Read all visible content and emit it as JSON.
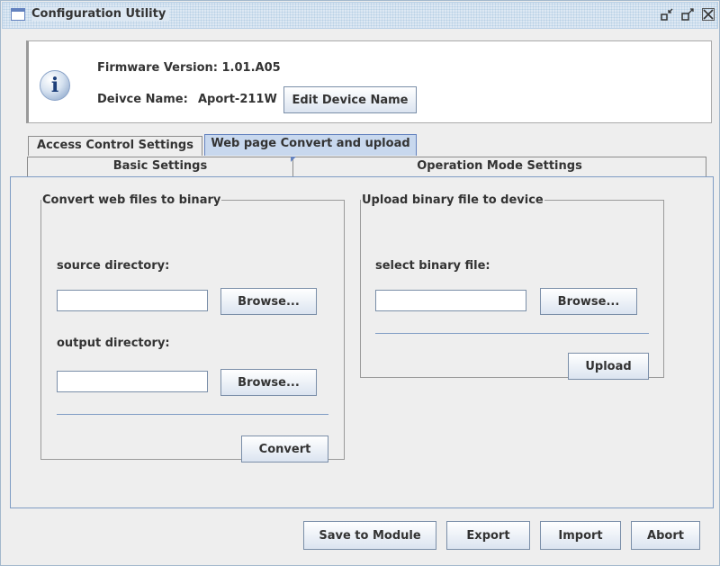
{
  "window": {
    "title": "Configuration Utility",
    "controls": {
      "minimize": "▫",
      "maximize": "▫",
      "close": "X"
    }
  },
  "device_info": {
    "firmware_label": "Firmware Version: 1.01.A05",
    "device_name_label": "Deivce Name:",
    "device_name_value": "Aport-211W",
    "edit_button": "Edit Device Name",
    "icon": "info-icon"
  },
  "tabs": {
    "row1": [
      {
        "label": "Access Control Settings",
        "selected": false
      },
      {
        "label": "Web page Convert and upload",
        "selected": true
      }
    ],
    "row2": [
      {
        "label": "Basic Settings",
        "selected": false
      },
      {
        "label": "Operation Mode Settings",
        "selected": false
      }
    ]
  },
  "convert_panel": {
    "legend": "Convert web files to binary",
    "source_label": "source directory:",
    "source_value": "",
    "source_browse": "Browse...",
    "output_label": "output directory:",
    "output_value": "",
    "output_browse": "Browse...",
    "convert_button": "Convert"
  },
  "upload_panel": {
    "legend": "Upload binary file to device",
    "file_label": "select binary file:",
    "file_value": "",
    "browse": "Browse...",
    "upload_button": "Upload"
  },
  "footer": {
    "save": "Save to Module",
    "export": "Export",
    "import": "Import",
    "abort": "Abort"
  },
  "colors": {
    "accent": "#6382bf",
    "selected_tab": "#c8d8ee",
    "panel_bg": "#eeeeee"
  }
}
